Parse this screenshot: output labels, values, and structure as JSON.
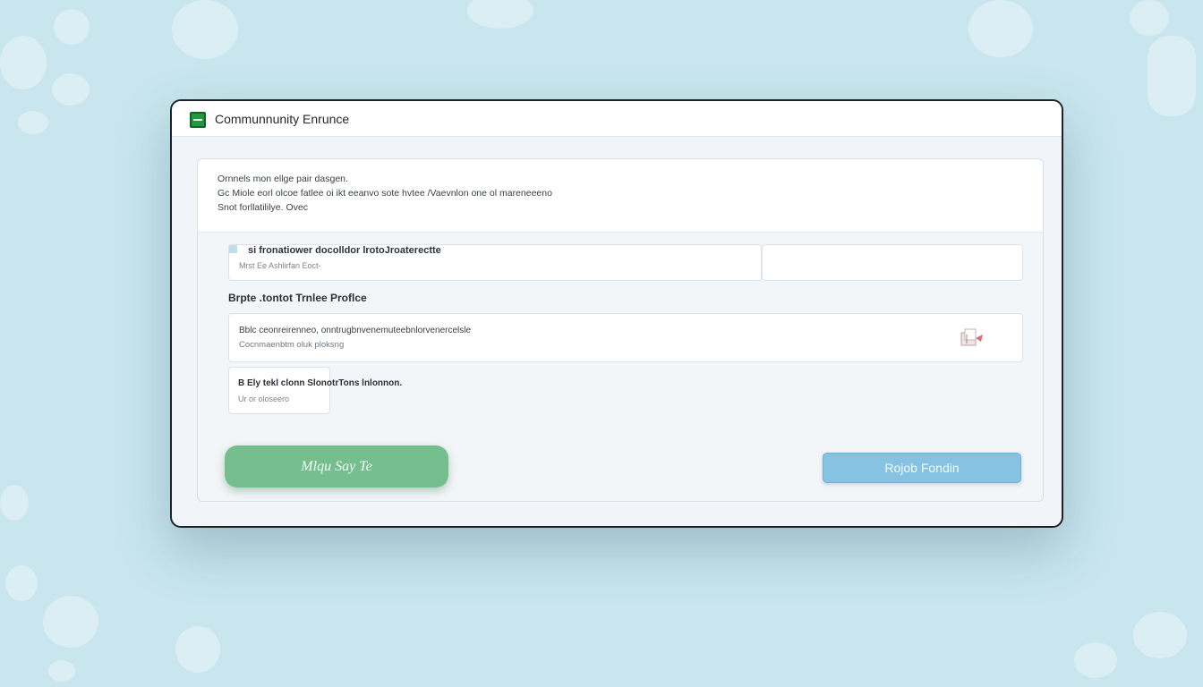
{
  "window": {
    "title": "Communnunity Enrunce"
  },
  "intro": {
    "line1": "Ornnels mon ellge pair dasgen.",
    "line2": "Gc Miole eorl olcoe fatlee oi ikt eeanvo sote hvtee /Vaevnlon one ol mareneeeno",
    "line3": "Snot forllatililye. Ovec"
  },
  "form": {
    "field_label": "si fronatiower docolldor lrotoJroaterectte",
    "field_help": "Mrst Ee Ashlirfan Eoct-",
    "section_title": "Brpte .tontot Trnlee Proflce",
    "profile_line1": "Bblc ceonreirenneo, onntrugbnvenemuteebnlorvenercelsle",
    "profile_line2": "Cocnmaenbtm oluk ploksng",
    "small_line1": "B Ely tekl clonn SlonotrTons lnlonnon.",
    "small_line2": "Ur  or oloseero"
  },
  "buttons": {
    "primary_label": "Mlqu Say Te",
    "secondary_label": "Rojob Fondin"
  },
  "icons": {
    "app": "app-icon",
    "upload": "upload-icon"
  },
  "colors": {
    "primary": "#74bf8d",
    "secondary": "#86c3e2",
    "app_icon": "#1f9a3e"
  }
}
